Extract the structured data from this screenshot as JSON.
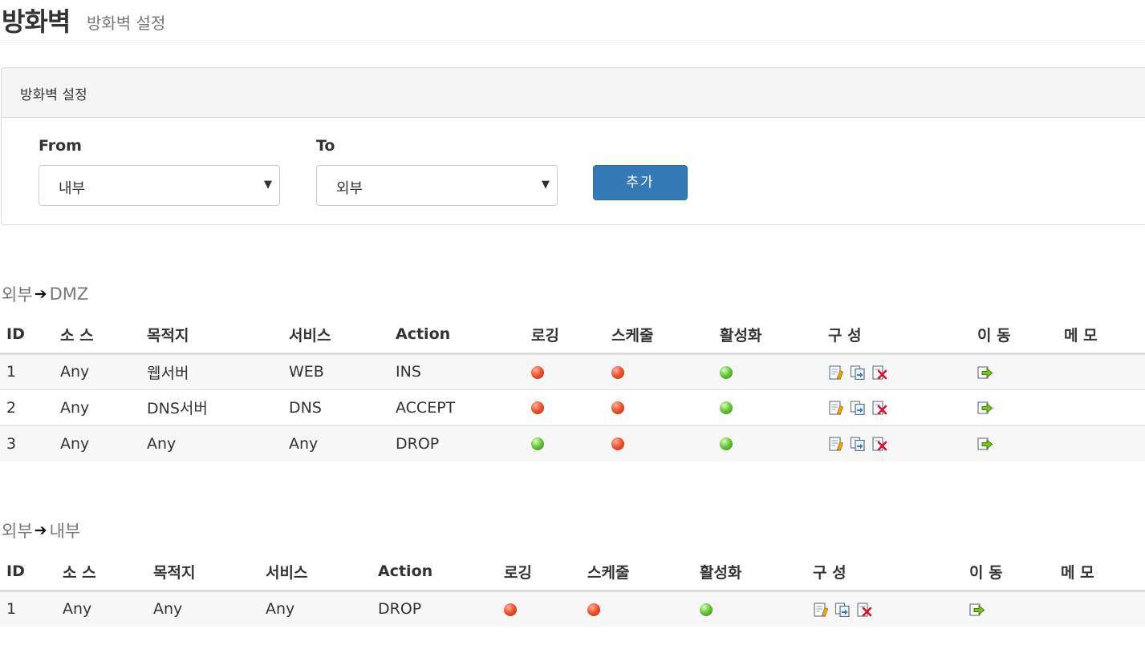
{
  "header": {
    "title": "방화벽",
    "subtitle": "방화벽 설정"
  },
  "panel": {
    "heading": "방화벽 설정",
    "from_label": "From",
    "from_value": "내부",
    "to_label": "To",
    "to_value": "외부",
    "add_label": "추가"
  },
  "colors": {
    "primary_button": "#337ab7",
    "status_on": "#6cc93a",
    "status_off": "#f0552f"
  },
  "sections": [
    {
      "from": "외부",
      "to": "DMZ",
      "columns": [
        "ID",
        "소 스",
        "목적지",
        "서비스",
        "Action",
        "로깅",
        "스케줄",
        "활성화",
        "구 성",
        "이 동",
        "메 모"
      ],
      "rows": [
        {
          "id": "1",
          "source": "Any",
          "destination": "웹서버",
          "service": "WEB",
          "action": "INS",
          "logging": "off",
          "schedule": "off",
          "enabled": "on",
          "memo": ""
        },
        {
          "id": "2",
          "source": "Any",
          "destination": "DNS서버",
          "service": "DNS",
          "action": "ACCEPT",
          "logging": "off",
          "schedule": "off",
          "enabled": "on",
          "memo": ""
        },
        {
          "id": "3",
          "source": "Any",
          "destination": "Any",
          "service": "Any",
          "action": "DROP",
          "logging": "on",
          "schedule": "off",
          "enabled": "on",
          "memo": ""
        }
      ]
    },
    {
      "from": "외부",
      "to": "내부",
      "columns": [
        "ID",
        "소 스",
        "목적지",
        "서비스",
        "Action",
        "로깅",
        "스케줄",
        "활성화",
        "구 성",
        "이 동",
        "메 모"
      ],
      "rows": [
        {
          "id": "1",
          "source": "Any",
          "destination": "Any",
          "service": "Any",
          "action": "DROP",
          "logging": "off",
          "schedule": "off",
          "enabled": "on",
          "memo": ""
        }
      ]
    }
  ],
  "icons": {
    "edit": "edit-icon",
    "copy": "copy-icon",
    "delete": "delete-icon",
    "move": "move-icon",
    "arrow": "right-arrow-icon"
  }
}
